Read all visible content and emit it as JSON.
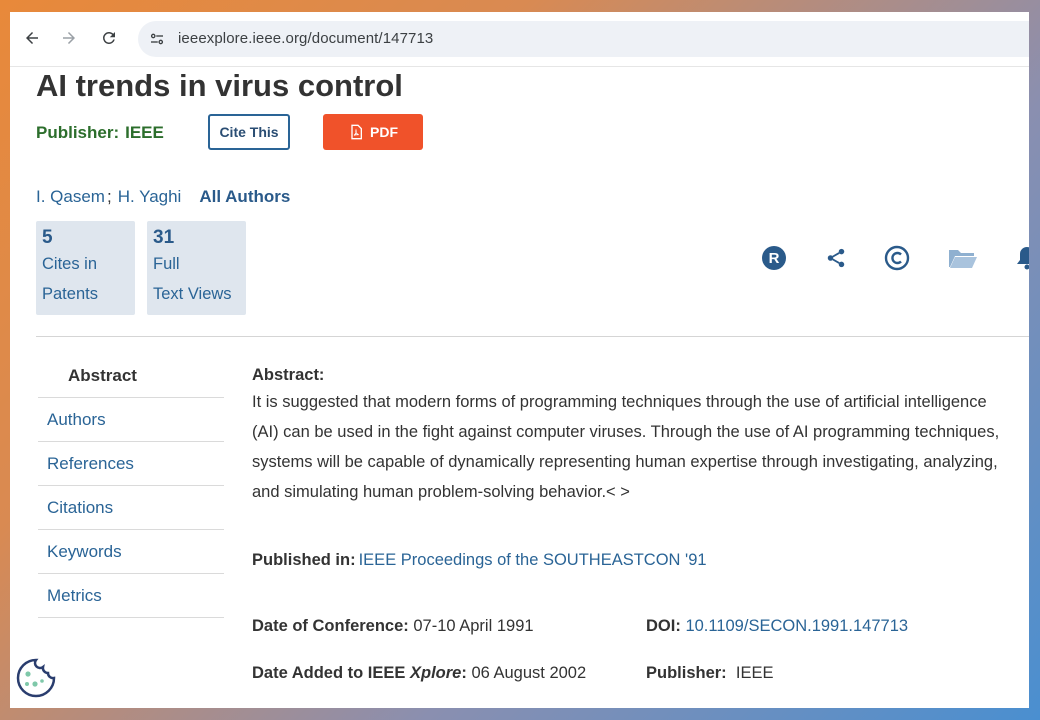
{
  "browser": {
    "url": "ieeexplore.ieee.org/document/147713"
  },
  "document": {
    "title": "AI trends in virus control",
    "publisher_label": "Publisher:",
    "publisher_value": "IEEE",
    "cite_button": "Cite This",
    "pdf_button": "PDF",
    "authors": [
      "I. Qasem",
      "H. Yaghi"
    ],
    "author_separator": ";",
    "all_authors": "All Authors",
    "metrics": [
      {
        "number": "5",
        "label_line1": "Cites in",
        "label_line2": "Patents"
      },
      {
        "number": "31",
        "label_line1": "Full",
        "label_line2": "Text Views"
      }
    ]
  },
  "action_icons": [
    "rights-icon",
    "share-icon",
    "copyright-icon",
    "folder-icon",
    "bell-icon"
  ],
  "side_nav": {
    "items": [
      "Abstract",
      "Authors",
      "References",
      "Citations",
      "Keywords",
      "Metrics"
    ],
    "active": "Abstract"
  },
  "abstract": {
    "heading": "Abstract:",
    "text": "It is suggested that modern forms of programming techniques through the use of artificial intelligence (AI) can be used in the fight against computer viruses. Through the use of AI programming techniques, systems will be capable of dynamically representing human expertise through investigating, analyzing, and simulating human problem-solving behavior.< >"
  },
  "published_in": {
    "label": "Published in:",
    "value": "IEEE Proceedings of the SOUTHEASTCON '91"
  },
  "meta": {
    "date_conf_label": "Date of Conference:",
    "date_conf_value": "07-10 April 1991",
    "doi_label": "DOI:",
    "doi_value": "10.1109/SECON.1991.147713",
    "date_added_label_prefix": "Date Added to IEEE",
    "date_added_label_italic": "Xplore",
    "date_added_label_suffix": ":",
    "date_added_value": "06 August 2002",
    "publisher_label": "Publisher:",
    "publisher_value": "IEEE"
  },
  "colors": {
    "link": "#2a6496",
    "publisher_green": "#2c6e2c",
    "pdf_red": "#f0522a",
    "metric_bg": "#dfe6ee"
  }
}
